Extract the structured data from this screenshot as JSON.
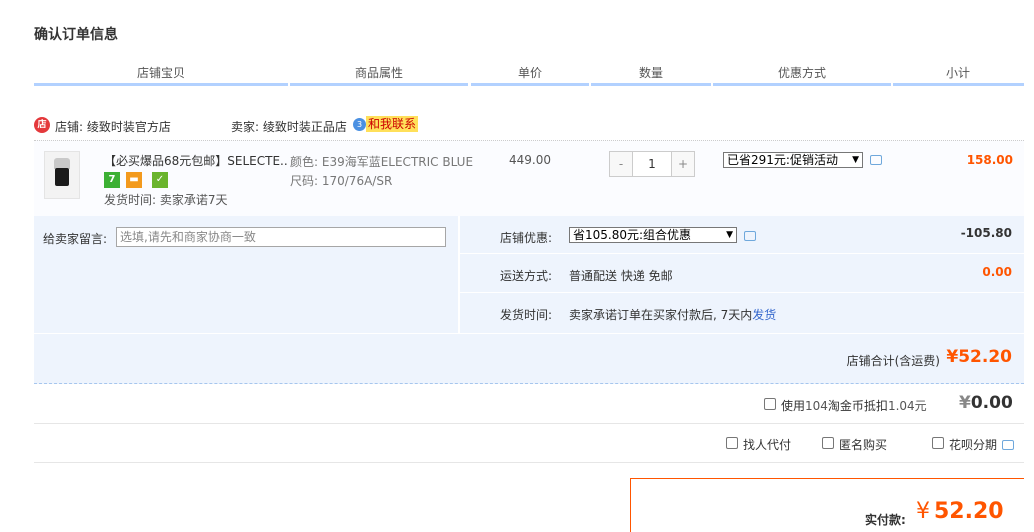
{
  "page": {
    "title": "确认订单信息"
  },
  "header": {
    "columns": [
      "店铺宝贝",
      "商品属性",
      "单价",
      "数量",
      "优惠方式",
      "小计"
    ]
  },
  "shop": {
    "icon": "shop-icon",
    "shop_label": "店铺: 绫致时装官方店",
    "seller_label": "卖家: 绫致时装正品店",
    "contact_label": "和我联系"
  },
  "item": {
    "title": "【必买爆品68元包邮】SELECTE...",
    "badges": [
      "7",
      "card",
      "shield"
    ],
    "ship_time": "发货时间: 卖家承诺7天",
    "attr_color": "颜色: E39海军蓝ELECTRIC BLUE",
    "attr_size": "尺码: 170/76A/SR",
    "unit_price": "449.00",
    "qty_minus": "-",
    "qty_value": "1",
    "qty_plus": "+",
    "promo_select": "已省291元:促销活动",
    "subtotal": "158.00"
  },
  "message": {
    "label": "给卖家留言:",
    "placeholder": "选填,请先和商家协商一致"
  },
  "shop_discount": {
    "label": "店铺优惠:",
    "select": "省105.80元:组合优惠",
    "amount": "-105.80"
  },
  "shipping": {
    "label": "运送方式:",
    "value": "普通配送 快递 免邮",
    "amount": "0.00"
  },
  "delivery": {
    "label": "发货时间:",
    "value": "卖家承诺订单在买家付款后, 7天内",
    "link": "发货"
  },
  "shop_total": {
    "label": "店铺合计(含运费)",
    "amount": "¥52.20"
  },
  "coins": {
    "label_prefix": "使用",
    "coin_count": "104",
    "label_middle": "淘金币抵扣",
    "coin_value": "1.04元",
    "yen": "¥",
    "amount": "0.00"
  },
  "options": [
    "找人代付",
    "匿名购买",
    "花呗分期"
  ],
  "payment": {
    "label": "实付款:",
    "yen": "¥",
    "amount": "52.20"
  },
  "colors": {
    "accent": "#ff5500",
    "header_bar": "#b2d1ff",
    "panel_bg": "#eef4fd",
    "link": "#3366cc"
  }
}
